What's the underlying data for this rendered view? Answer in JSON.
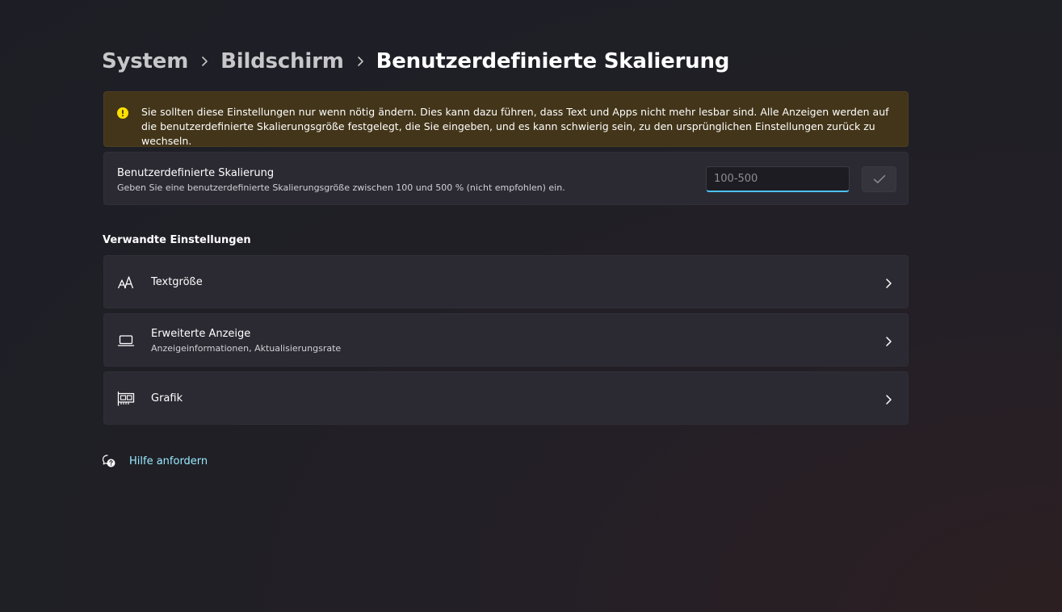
{
  "breadcrumb": {
    "items": [
      "System",
      "Bildschirm"
    ],
    "current": "Benutzerdefinierte Skalierung",
    "separator_icon": "chevron-right-icon"
  },
  "warning": {
    "icon": "warning-icon",
    "text": "Sie sollten diese Einstellungen nur wenn nötig ändern. Dies kann dazu führen, dass Text und Apps nicht mehr lesbar sind. Alle Anzeigen werden auf die benutzerdefinierte Skalierungsgröße festgelegt, die Sie eingeben, und es kann schwierig sein, zu den ursprünglichen Einstellungen zurück zu wechseln."
  },
  "custom_scaling": {
    "title": "Benutzerdefinierte Skalierung",
    "description": "Geben Sie eine benutzerdefinierte Skalierungsgröße zwischen 100 und 500 % (nicht empfohlen) ein.",
    "input_value": "",
    "input_placeholder": "100-500",
    "apply_icon": "checkmark-icon"
  },
  "related": {
    "heading": "Verwandte Einstellungen",
    "items": [
      {
        "label": "Textgröße",
        "sub": "",
        "icon": "text-size-icon"
      },
      {
        "label": "Erweiterte Anzeige",
        "sub": "Anzeigeinformationen, Aktualisierungsrate",
        "icon": "laptop-icon"
      },
      {
        "label": "Grafik",
        "sub": "",
        "icon": "graphics-card-icon"
      }
    ]
  },
  "help": {
    "label": "Hilfe anfordern",
    "icon": "help-icon"
  },
  "colors": {
    "background": "#1f1f26",
    "card": "#2b2a33",
    "warning_background": "#433519",
    "warning_icon": "#fce100",
    "accent": "#4cc2ff",
    "link": "#99ebff"
  }
}
